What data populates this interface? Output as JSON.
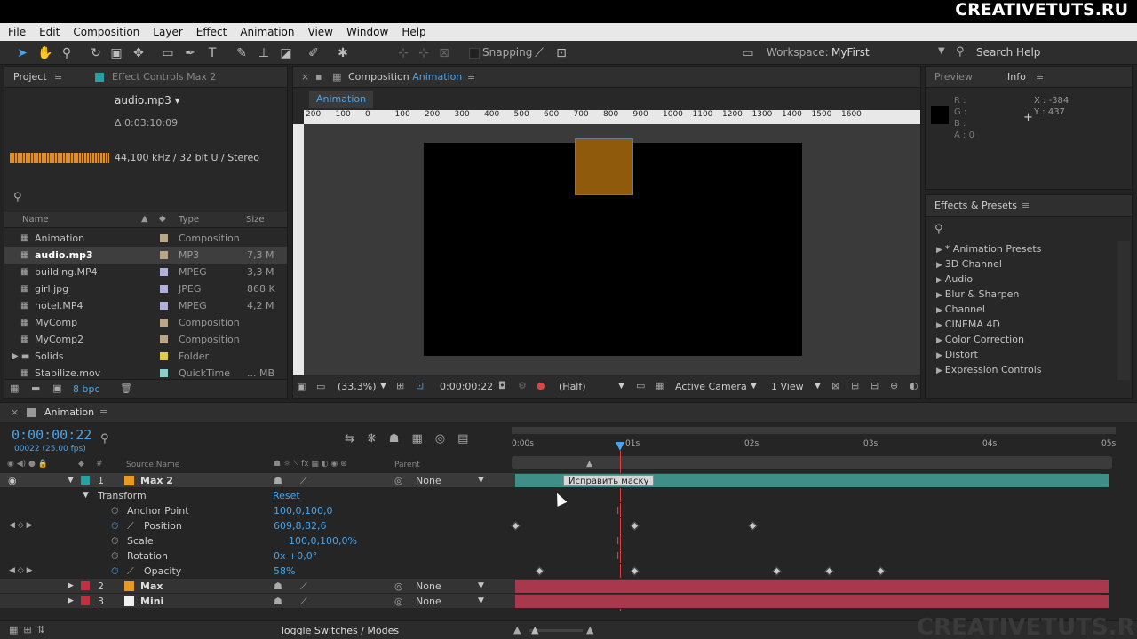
{
  "brand": "CREATIVETUTS.RU",
  "watermark": "CREATIVETUTS.RU",
  "menu": [
    "File",
    "Edit",
    "Composition",
    "Layer",
    "Effect",
    "Animation",
    "View",
    "Window",
    "Help"
  ],
  "toolbar": {
    "snapping": "Snapping",
    "workspace_label": "Workspace:",
    "workspace_value": "MyFirst",
    "search_help": "Search Help"
  },
  "project": {
    "tab": "Project",
    "tab2": "Effect Controls Max 2",
    "selected_name": "audio.mp3 ▾",
    "duration": "Δ 0:03:10:09",
    "audio_info": "44,100 kHz / 32 bit U / Stereo",
    "col_name": "Name",
    "col_type": "Type",
    "col_size": "Size",
    "bpc": "8 bpc",
    "items": [
      {
        "name": "Animation",
        "type": "Composition",
        "size": "",
        "label": "#b9a68a"
      },
      {
        "name": "audio.mp3",
        "type": "MP3",
        "size": "7,3 M",
        "label": "#b9a68a"
      },
      {
        "name": "building.MP4",
        "type": "MPEG",
        "size": "3,3 M",
        "label": "#b0b0d8"
      },
      {
        "name": "girl.jpg",
        "type": "JPEG",
        "size": "868 K",
        "label": "#b0b0d8"
      },
      {
        "name": "hotel.MP4",
        "type": "MPEG",
        "size": "4,2 M",
        "label": "#b0b0d8"
      },
      {
        "name": "MyComp",
        "type": "Composition",
        "size": "",
        "label": "#b9a68a"
      },
      {
        "name": "MyComp2",
        "type": "Composition",
        "size": "",
        "label": "#b9a68a"
      },
      {
        "name": "Solids",
        "type": "Folder",
        "size": "",
        "label": "#e0d040"
      },
      {
        "name": "Stabilize.mov",
        "type": "QuickTime",
        "size": "... MB",
        "label": "#8ad0c8"
      }
    ]
  },
  "composition": {
    "tab_prefix": "Composition",
    "tab_name": "Animation",
    "subtab": "Animation",
    "ruler": [
      "200",
      "100",
      "0",
      "100",
      "200",
      "300",
      "400",
      "500",
      "600",
      "700",
      "800",
      "900",
      "1000",
      "1100",
      "1200",
      "1300",
      "1400",
      "1500",
      "1600"
    ],
    "zoom": "(33,3%)",
    "time": "0:00:00:22",
    "resolution": "(Half)",
    "camera": "Active Camera",
    "views": "1 View"
  },
  "info": {
    "tab_preview": "Preview",
    "tab_info": "Info",
    "r": "R :",
    "g": "G :",
    "b": "B :",
    "a": "A : 0",
    "x": "X : -384",
    "y": "Y : 437"
  },
  "effects": {
    "tab": "Effects & Presets",
    "items": [
      "* Animation Presets",
      "3D Channel",
      "Audio",
      "Blur & Sharpen",
      "Channel",
      "CINEMA 4D",
      "Color Correction",
      "Distort",
      "Expression Controls"
    ]
  },
  "timeline": {
    "tab": "Animation",
    "timecode": "0:00:00:22",
    "fps": "00022 (25.00 fps)",
    "col_source": "Source Name",
    "col_parent": "Parent",
    "ticks": [
      "0:00s",
      "01s",
      "02s",
      "03s",
      "04s",
      "05s"
    ],
    "tooltip": "Исправить маску",
    "toggle": "Toggle Switches / Modes",
    "layer1": {
      "num": "1",
      "name": "Max 2",
      "parent": "None"
    },
    "transform": "Transform",
    "reset": "Reset",
    "props": [
      {
        "name": "Anchor Point",
        "value": "100,0,100,0"
      },
      {
        "name": "Position",
        "value": "609,8,82,6"
      },
      {
        "name": "Scale",
        "value": "100,0,100,0%"
      },
      {
        "name": "Rotation",
        "value": "0x +0,0°"
      },
      {
        "name": "Opacity",
        "value": "58%"
      }
    ],
    "layer2": {
      "num": "2",
      "name": "Max",
      "parent": "None"
    },
    "layer3": {
      "num": "3",
      "name": "Mini",
      "parent": "None"
    }
  }
}
